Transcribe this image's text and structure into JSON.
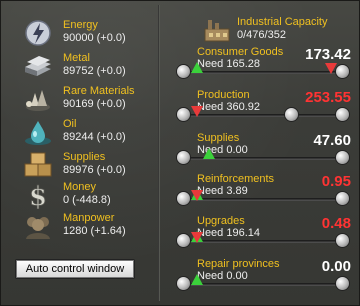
{
  "resources": [
    {
      "name": "Energy",
      "value": "90000 (+0.0)",
      "icon": "lightning-icon"
    },
    {
      "name": "Metal",
      "value": "89752 (+0.0)",
      "icon": "metal-bars-icon"
    },
    {
      "name": "Rare Materials",
      "value": "90169 (+0.0)",
      "icon": "rare-materials-icon"
    },
    {
      "name": "Oil",
      "value": "89244 (+0.0)",
      "icon": "oil-icon"
    },
    {
      "name": "Supplies",
      "value": "89976 (+0.0)",
      "icon": "supplies-crates-icon"
    },
    {
      "name": "Money",
      "value": "0 (-448.8)",
      "icon": "dollar-icon"
    },
    {
      "name": "Manpower",
      "value": "1280 (+1.64)",
      "icon": "manpower-icon"
    }
  ],
  "auto_control_label": "Auto control window",
  "industrial_capacity": {
    "label": "Industrial Capacity",
    "value": "0/476/352"
  },
  "allocations": [
    {
      "name": "Consumer Goods",
      "need": "Need 165.28",
      "value": "173.42",
      "color": "#ffffff"
    },
    {
      "name": "Production",
      "need": "Need 360.92",
      "value": "253.55",
      "color": "#ff3333"
    },
    {
      "name": "Supplies",
      "need": "Need 0.00",
      "value": "47.60",
      "color": "#ffffff"
    },
    {
      "name": "Reinforcements",
      "need": "Need 3.89",
      "value": "0.95",
      "color": "#ff3333"
    },
    {
      "name": "Upgrades",
      "need": "Need 196.14",
      "value": "0.48",
      "color": "#ff3333"
    },
    {
      "name": "Repair provinces",
      "need": "Need 0.00",
      "value": "0.00",
      "color": "#ffffff"
    }
  ],
  "colors": {
    "label": "#f0c020",
    "value": "#eeeeee",
    "deficit": "#ff3333",
    "ok": "#ffffff"
  }
}
